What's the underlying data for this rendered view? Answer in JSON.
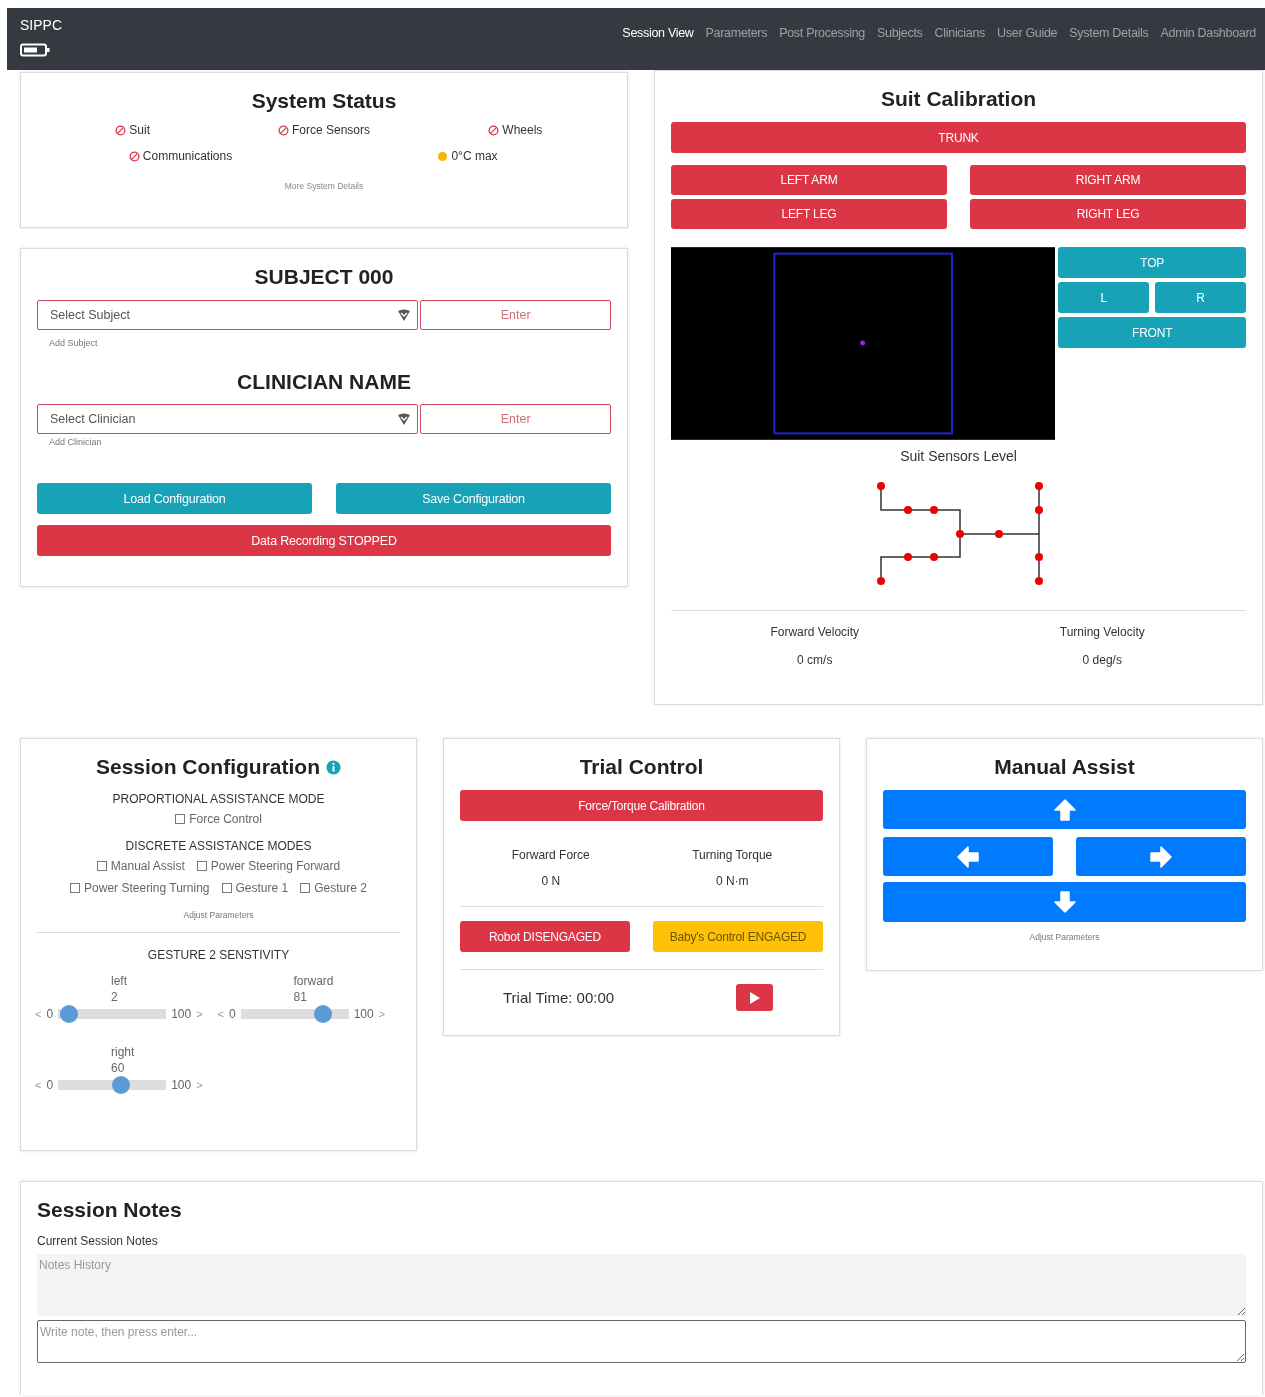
{
  "navbar": {
    "brand": "SIPPC",
    "links": [
      {
        "label": "Session View",
        "selected": true
      },
      {
        "label": "Parameters",
        "selected": false
      },
      {
        "label": "Post Processing",
        "selected": false
      },
      {
        "label": "Subjects",
        "selected": false
      },
      {
        "label": "Clinicians",
        "selected": false
      },
      {
        "label": "User Guide",
        "selected": false
      },
      {
        "label": "System Details",
        "selected": false
      },
      {
        "label": "Admin Dashboard",
        "selected": false
      }
    ]
  },
  "system_status": {
    "title": "System Status",
    "rows": [
      [
        {
          "label": "Suit",
          "kind": "error"
        },
        {
          "label": "Force Sensors",
          "kind": "error"
        },
        {
          "label": "Wheels",
          "kind": "error"
        }
      ],
      [
        {
          "label": "Communications",
          "kind": "error"
        },
        {
          "label": "0°C max",
          "kind": "warning"
        }
      ]
    ],
    "link": "More System Details"
  },
  "subject": {
    "title": "SUBJECT 000",
    "placeholder": "Select Subject",
    "enter": "Enter",
    "add_link": "Add Subject"
  },
  "clinician": {
    "title": "CLINICIAN NAME",
    "placeholder": "Select Clinician",
    "enter": "Enter",
    "add_link": "Add Clinician"
  },
  "config_buttons": [
    "Load Configuration",
    "Save Configuration"
  ],
  "recording_button": "Data Recording STOPPED",
  "suit_calibration": {
    "title": "Suit Calibration",
    "trunk": "TRUNK",
    "limbs": [
      [
        "LEFT ARM",
        "RIGHT ARM"
      ],
      [
        "LEFT LEG",
        "RIGHT LEG"
      ]
    ],
    "views": {
      "top": "TOP",
      "left": "L",
      "right": "R",
      "front": "FRONT"
    },
    "sensors_label": "Suit Sensors Level",
    "readouts": [
      {
        "label": "Forward Velocity",
        "value": "0 cm/s"
      },
      {
        "label": "Turning Velocity",
        "value": "0 deg/s"
      }
    ]
  },
  "session_configuration": {
    "title": "Session Configuration",
    "sections": [
      {
        "heading": "PROPORTIONAL ASSISTANCE MODE",
        "rows": [
          [
            {
              "label": "Force Control",
              "checked": false
            }
          ]
        ]
      },
      {
        "heading": "DISCRETE ASSISTANCE MODES",
        "rows": [
          [
            {
              "label": "Manual Assist",
              "checked": false
            },
            {
              "label": "Power Steering Forward",
              "checked": false
            }
          ],
          [
            {
              "label": "Power Steering Turning",
              "checked": false
            },
            {
              "label": "Gesture 1",
              "checked": false
            },
            {
              "label": "Gesture 2",
              "checked": false
            }
          ]
        ]
      }
    ],
    "adjust_link": "Adjust Parameters",
    "sensitivity_heading": "GESTURE 2 SENSTIVITY",
    "sliders": [
      {
        "label": "left",
        "value": "2",
        "prev": "<",
        "min": "0",
        "max": "100",
        "next": ">",
        "level": 0.02
      },
      {
        "label": "forward",
        "value": "81",
        "prev": "<",
        "min": "0",
        "max": "100",
        "next": ">",
        "level": 0.81
      },
      {
        "label": "right",
        "value": "60",
        "prev": "<",
        "min": "0",
        "max": "100",
        "next": ">",
        "level": 0.6
      }
    ]
  },
  "trial_control": {
    "title": "Trial Control",
    "calibration_button": "Force/Torque Calibration",
    "readouts": [
      {
        "label": "Forward Force",
        "value": "0 N"
      },
      {
        "label": "Turning Torque",
        "value": "0 N·m"
      }
    ],
    "status_buttons": [
      {
        "label": "Robot DISENGAGED",
        "kind": "danger"
      },
      {
        "label": "Baby's Control ENGAGED",
        "kind": "warning"
      }
    ],
    "trial_time": "Trial Time: 00:00"
  },
  "manual_assist": {
    "title": "Manual Assist",
    "adjust_link": "Adjust Parameters"
  },
  "session_notes": {
    "title": "Session Notes",
    "subtitle": "Current Session Notes",
    "history_placeholder": "Notes History",
    "note_placeholder": "Write note, then press enter..."
  }
}
